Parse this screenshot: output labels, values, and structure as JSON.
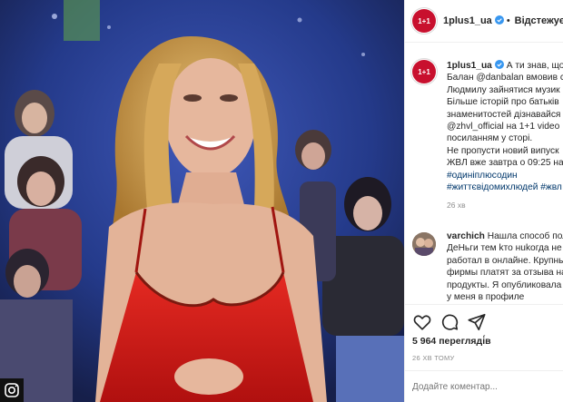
{
  "post": {
    "username": "1plus1_ua",
    "follow_label": "Відстежуєть",
    "logo_text": "1+1",
    "caption_lines": [
      "А ти знав, що с",
      "Балан @danbalan вмовив с",
      "Людмилу зайнятися музик",
      "Більше історій про батьків",
      "знаменитостей дізнавайся",
      "@zhvl_official на 1+1 video",
      "посиланням у сторі.",
      "Не пропусти новий випуск",
      "ЖВЛ вже завтра о 09:25 на",
      "#одиніплюсодин",
      "#життєвідомихлюдей #жвл"
    ],
    "caption_time": "26 хв",
    "comment": {
      "username": "varchich",
      "lines": [
        "Нашла способ пол",
        "ДеНьги тем kто нukогда не",
        "работал в онлайне. Крупны",
        "фирмы платят за отзыва на",
        "продукты. Я опубликовала",
        "у меня в профиле"
      ]
    },
    "likes_text": "5 964 перегляді́в",
    "date_text": "26 ХВ ТОМУ",
    "comment_placeholder": "Додайте коментар..."
  },
  "colors": {
    "brand_red": "#c8102e",
    "verified_blue": "#3897f0",
    "link_blue": "#00376b",
    "backdrop_blue": "#2b3a7a",
    "dress_red": "#d81c1c"
  },
  "icons": [
    "heart-icon",
    "comment-icon",
    "share-icon",
    "verified-icon",
    "more-icon"
  ]
}
